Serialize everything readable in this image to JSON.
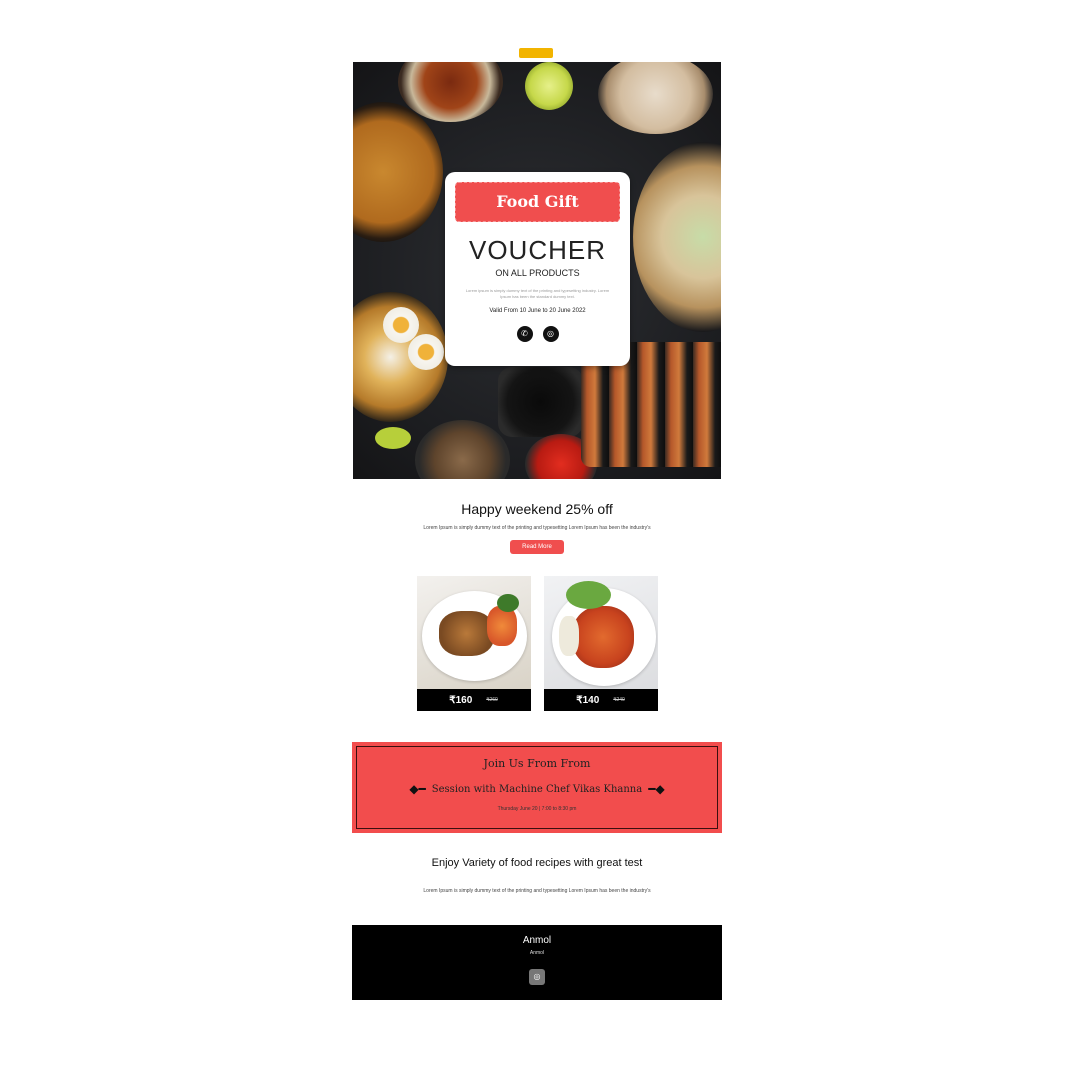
{
  "hero": {
    "gift_label": "Food Gift",
    "voucher_title": "VOUCHER",
    "voucher_subtitle": "ON ALL PRODUCTS",
    "description": "Lorem ipsum is simply dummy text of the printing and typesetting industry. Lorem Ipsum has been the standard dummy text.",
    "valid_text": "Valid From 10 June to 20 June 2022",
    "icons": [
      "phone-icon",
      "instagram-icon"
    ]
  },
  "offer": {
    "title": "Happy weekend 25% off",
    "text": "Lorem Ipsum is simply dummy text of the printing and typesetting Lorem Ipsum has been the industry's",
    "button_label": "Read More"
  },
  "products": [
    {
      "price": "₹160",
      "old_price": "₹260"
    },
    {
      "price": "₹140",
      "old_price": "₹240"
    }
  ],
  "event": {
    "title": "Join Us From From",
    "subtitle": "Session with Machine Chef Vikas Khanna",
    "date_text": "Thursday June 20 | 7:00 to 8:30 pm"
  },
  "enjoy": {
    "title": "Enjoy Variety of food recipes with great test",
    "text": "Lorem Ipsum is simply dummy text of the printing and typesetting Lorem Ipsum has been the industry's"
  },
  "footer": {
    "name": "Anmol",
    "subtext": "Anmol",
    "icon": "instagram-icon"
  },
  "colors": {
    "accent": "#f04e4e",
    "footer_bg": "#000000",
    "tab_marker": "#f2b400"
  }
}
